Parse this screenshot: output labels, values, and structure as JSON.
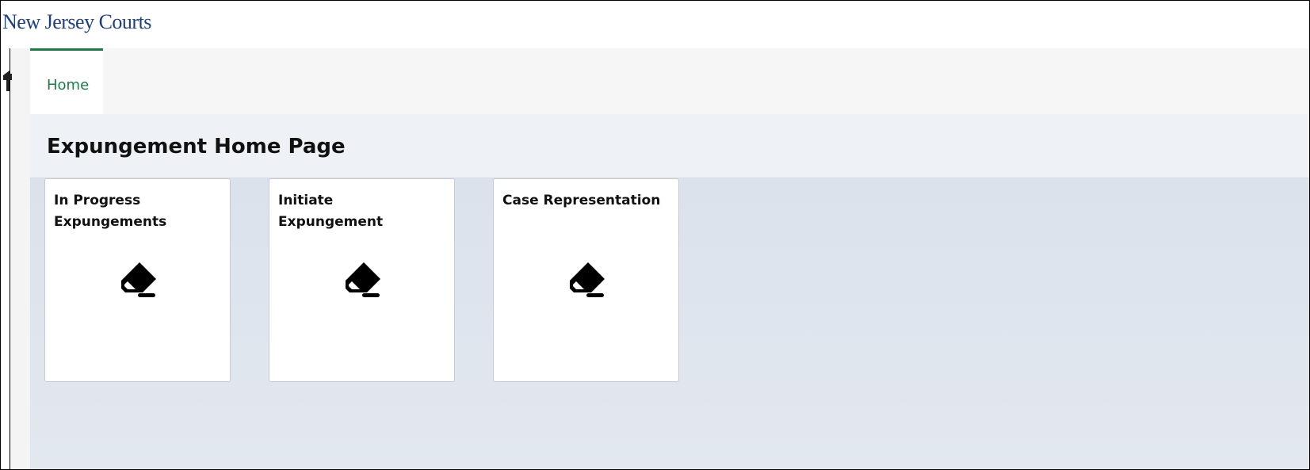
{
  "header": {
    "brand": "New Jersey Courts"
  },
  "nav": {
    "tabs": [
      {
        "label": "Home",
        "active": true
      }
    ]
  },
  "main": {
    "title": "Expungement Home Page",
    "tiles": [
      {
        "title": "In Progress Expungements",
        "icon": "eraser-icon"
      },
      {
        "title": "Initiate Expungement",
        "icon": "eraser-icon"
      },
      {
        "title": "Case Representation",
        "icon": "eraser-icon"
      }
    ]
  },
  "colors": {
    "brand": "#1f3f7a",
    "accent": "#1f7a4a",
    "page_bg": "#eef1f5",
    "tile_area_bg": "#dbe2ec"
  }
}
